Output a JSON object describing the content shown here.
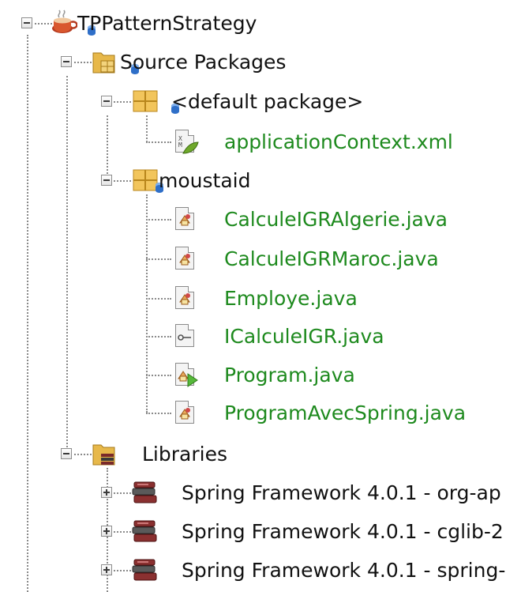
{
  "tree": {
    "project": {
      "name": "TPPatternStrategy",
      "icon": "java-project-icon"
    },
    "source_packages": {
      "label": "Source Packages",
      "icon": "source-packages-icon",
      "default_package": {
        "label": "<default package>",
        "files": [
          {
            "name": "applicationContext.xml",
            "icon": "xml-file-icon"
          }
        ]
      },
      "moustaid": {
        "label": "moustaid",
        "files": [
          {
            "name": "CalculeIGRAlgerie.java",
            "icon": "java-class-icon"
          },
          {
            "name": "CalculeIGRMaroc.java",
            "icon": "java-class-icon"
          },
          {
            "name": "Employe.java",
            "icon": "java-class-icon"
          },
          {
            "name": "ICalculeIGR.java",
            "icon": "java-interface-icon"
          },
          {
            "name": "Program.java",
            "icon": "java-main-class-icon"
          },
          {
            "name": "ProgramAvecSpring.java",
            "icon": "java-class-icon"
          }
        ]
      }
    },
    "libraries": {
      "label": "Libraries",
      "icon": "libraries-icon",
      "items": [
        {
          "name": "Spring Framework 4.0.1 - org-ap",
          "icon": "jar-library-icon"
        },
        {
          "name": "Spring Framework 4.0.1 - cglib-2",
          "icon": "jar-library-icon"
        },
        {
          "name": "Spring Framework 4.0.1 - spring-",
          "icon": "jar-library-icon"
        }
      ]
    }
  }
}
